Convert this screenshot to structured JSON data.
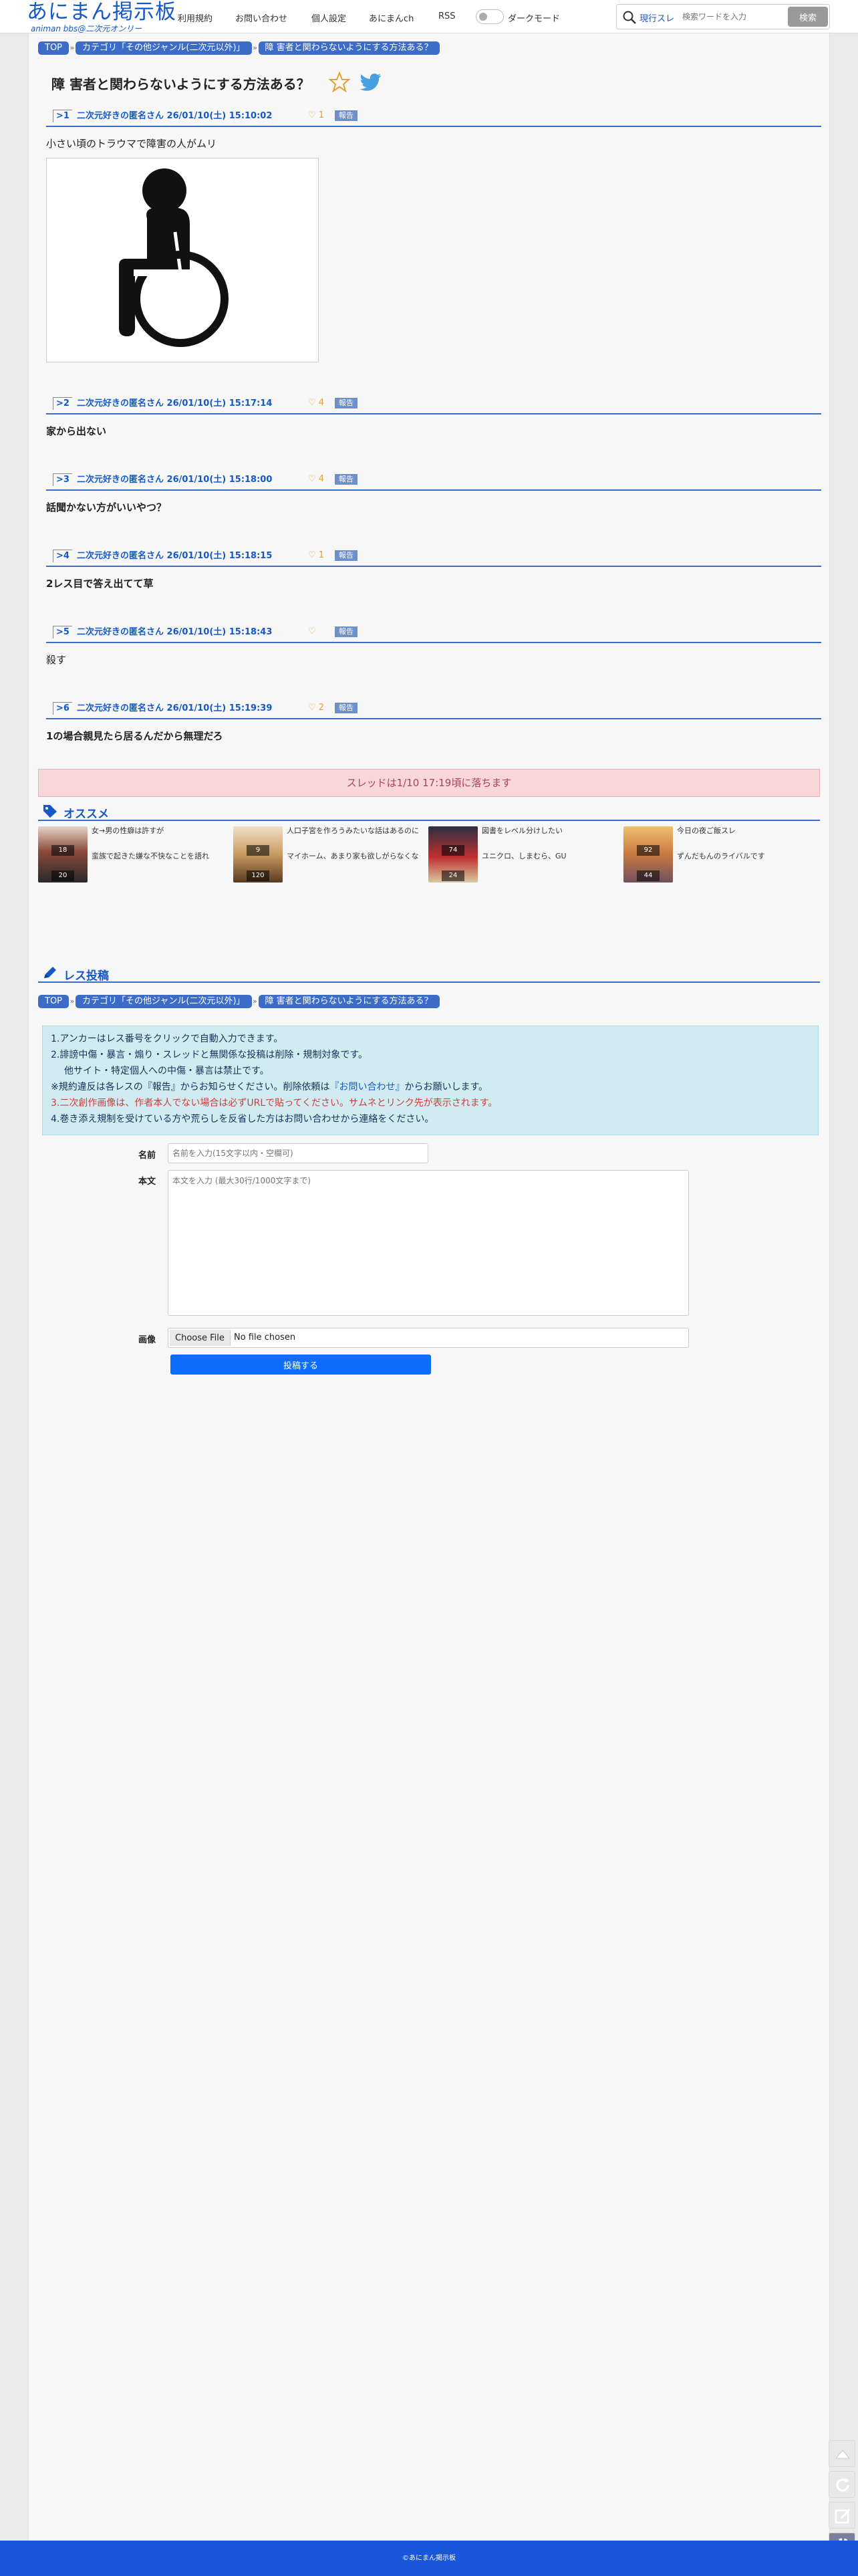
{
  "header": {
    "logo": "あにまん掲示板",
    "logo_sub": "animan bbs@二次元オンリー",
    "nav": [
      "利用規約",
      "お問い合わせ",
      "個人設定",
      "あにまんch",
      "RSS"
    ],
    "dark_mode_label": "ダークモード",
    "search": {
      "scope": "現行スレ",
      "placeholder": "検索ワードを入力",
      "button": "検索"
    }
  },
  "breadcrumb": [
    "TOP",
    "カテゴリ「その他ジャンル(二次元以外)」",
    "障 害者と関わらないようにする方法ある？"
  ],
  "thread": {
    "title": "障 害者と関わらないようにする方法ある？"
  },
  "posts": [
    {
      "num": "1",
      "name": "二次元好きの匿名さん",
      "date": "26/01/10(土) 15:10:02",
      "likes": "1",
      "report": "報告",
      "body": "小さい頃のトラウマで障害の人がムリ"
    },
    {
      "num": "2",
      "name": "二次元好きの匿名さん",
      "date": "26/01/10(土) 15:17:14",
      "likes": "4",
      "report": "報告",
      "body": "家から出ない"
    },
    {
      "num": "3",
      "name": "二次元好きの匿名さん",
      "date": "26/01/10(土) 15:18:00",
      "likes": "4",
      "report": "報告",
      "body": "話聞かない方がいいやつ？"
    },
    {
      "num": "4",
      "name": "二次元好きの匿名さん",
      "date": "26/01/10(土) 15:18:15",
      "likes": "1",
      "report": "報告",
      "body": "2レス目で答え出てて草"
    },
    {
      "num": "5",
      "name": "二次元好きの匿名さん",
      "date": "26/01/10(土) 15:18:43",
      "likes": "",
      "report": "報告",
      "body": "殺す"
    },
    {
      "num": "6",
      "name": "二次元好きの匿名さん",
      "date": "26/01/10(土) 15:19:39",
      "likes": "2",
      "report": "報告",
      "body": "1の場合親見たら居るんだから無理だろ"
    }
  ],
  "notice": "スレッドは1/10 17:19頃に落ちます",
  "recommend": {
    "title": "オススメ",
    "items": [
      {
        "title1": "女→男の性癖は許すが",
        "title2": "蛮族で起きた嫌な不快なことを語れ",
        "badge_top": "18",
        "badge_bottom": "20"
      },
      {
        "title1": "人口子宮を作ろうみたいな話はあるのに",
        "title2": "マイホーム、あまり家も欲しがらなくなってしまう",
        "badge_top": "9",
        "badge_bottom": "120"
      },
      {
        "title1": "図書をレベル分けしたい",
        "title2": "ユニクロ、しまむら、GU",
        "badge_top": "74",
        "badge_bottom": "24"
      },
      {
        "title1": "今日の夜ご飯スレ",
        "title2": "ずんだもんのライバルです",
        "badge_top": "92",
        "badge_bottom": "44"
      }
    ]
  },
  "post_form": {
    "title": "レス投稿",
    "rules": [
      "1.アンカーはレス番号をクリックで自動入力できます。",
      "2.誹謗中傷・暴言・煽り・スレッドと無関係な投稿は削除・規制対象です。",
      "他サイト・特定個人への中傷・暴言は禁止です。",
      "※規約違反は各レスの『報告』からお知らせください。削除依頼は",
      "『お問い合わせ』",
      "からお願いします。",
      "3.二次創作画像は、作者本人でない場合は必ずURLで貼ってください。サムネとリンク先が表示されます。",
      "4.巻き添え規制を受けている方や荒らしを反省した方はお問い合わせから連絡をください。"
    ],
    "name_label": "名前",
    "name_placeholder": "名前を入力(15文字以内・空欄可)",
    "body_label": "本文",
    "body_placeholder": "本文を入力 (最大30行/1000文字まで)",
    "image_label": "画像",
    "file_button": "Choose File",
    "file_status": "No file chosen",
    "submit": "投稿する"
  },
  "footer": "©あにまん掲示板",
  "colors": {
    "accent": "#1559c6",
    "breadcrumb": "#3c6cc6",
    "notice_bg": "#f8d7da",
    "rules_bg": "#d1ecf1",
    "footer": "#1a56db"
  }
}
